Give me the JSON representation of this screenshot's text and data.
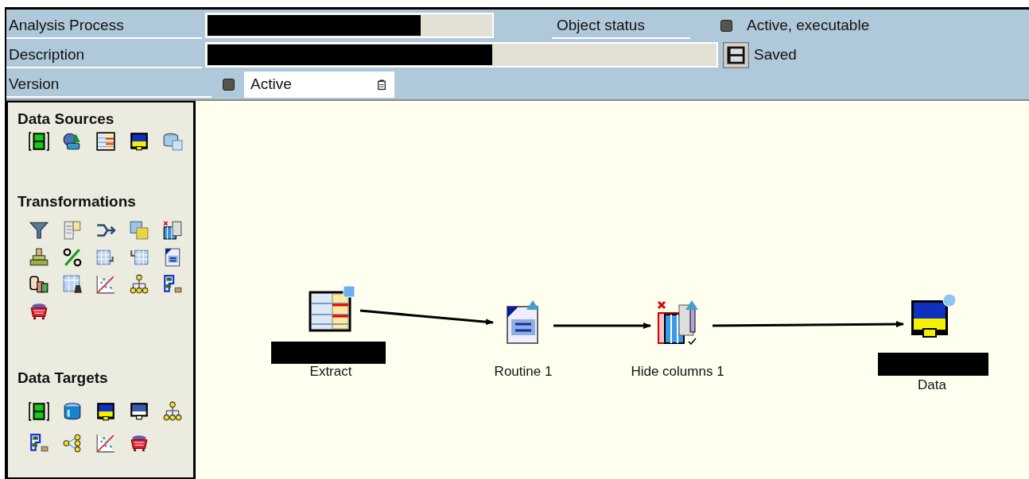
{
  "header": {
    "analysis_process": {
      "label": "Analysis Process"
    },
    "object_status": {
      "label": "Object status",
      "value": "Active, executable"
    },
    "description": {
      "label": "Description",
      "status": "Saved"
    },
    "version": {
      "label": "Version",
      "value": "Active"
    }
  },
  "palette": {
    "sections": [
      {
        "title": "Data Sources"
      },
      {
        "title": "Transformations"
      },
      {
        "title": "Data Targets"
      }
    ]
  },
  "canvas": {
    "nodes": [
      {
        "label": "Extract"
      },
      {
        "label": "Routine 1"
      },
      {
        "label": "Hide columns 1"
      },
      {
        "label": "Data"
      }
    ]
  }
}
